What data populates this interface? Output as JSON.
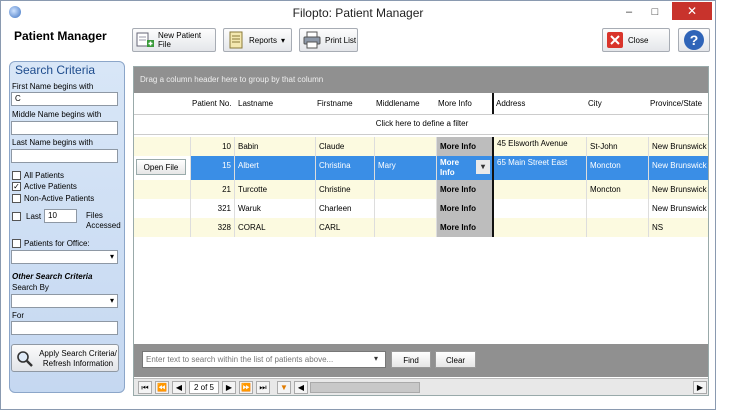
{
  "window": {
    "title": "Filopto: Patient Manager"
  },
  "page_title": "Patient Manager",
  "toolbar": {
    "new_patient_file": "New Patient File",
    "reports": "Reports",
    "print_list": "Print List",
    "close": "Close"
  },
  "search_criteria": {
    "title": "Search Criteria",
    "first_name_label": "First Name begins with",
    "first_name_value": "C",
    "middle_name_label": "Middle Name begins with",
    "last_name_label": "Last Name begins with",
    "all_patients": "All Patients",
    "active_patients": "Active Patients",
    "non_active_patients": "Non-Active Patients",
    "last_label": "Last",
    "last_value": "10",
    "files_accessed": "Files Accessed",
    "patients_for_office": "Patients for Office:",
    "other_title": "Other Search Criteria",
    "search_by_label": "Search By",
    "for_label": "For",
    "apply_button": "Apply Search Criteria/ Refresh Information"
  },
  "grid": {
    "group_hint": "Drag a column header here to group by that column",
    "filter_hint": "Click here to define a filter",
    "columns": [
      "Patient No.",
      "Lastname",
      "Firstname",
      "Middlename",
      "More Info",
      "Address",
      "City",
      "Province/State"
    ],
    "rows": [
      {
        "no": "10",
        "last": "Babin",
        "first": "Claude",
        "middle": "",
        "more": "More Info",
        "address": "45 Elsworth Avenue",
        "city": "St-John",
        "prov": "New Brunswick"
      },
      {
        "no": "15",
        "last": "Albert",
        "first": "Christina",
        "middle": "Mary",
        "more": "More Info",
        "address": "65 Main Street East",
        "city": "Moncton",
        "prov": "New Brunswick"
      },
      {
        "no": "21",
        "last": "Turcotte",
        "first": "Christine",
        "middle": "",
        "more": "More Info",
        "address": "",
        "city": "Moncton",
        "prov": "New Brunswick"
      },
      {
        "no": "321",
        "last": "Waruk",
        "first": "Charleen",
        "middle": "",
        "more": "More Info",
        "address": "",
        "city": "",
        "prov": "New Brunswick"
      },
      {
        "no": "328",
        "last": "CORAL",
        "first": "CARL",
        "middle": "",
        "more": "More Info",
        "address": "",
        "city": "",
        "prov": "NS"
      }
    ],
    "open_file_button": "Open File",
    "search_placeholder": "Enter text to search within the list of patients above...",
    "find_button": "Find",
    "clear_button": "Clear",
    "pager_text": "2 of 5"
  },
  "colors": {
    "selected_row": "#3a8ee6",
    "row_tint": "#fcfae0",
    "close_red": "#c8332c"
  }
}
